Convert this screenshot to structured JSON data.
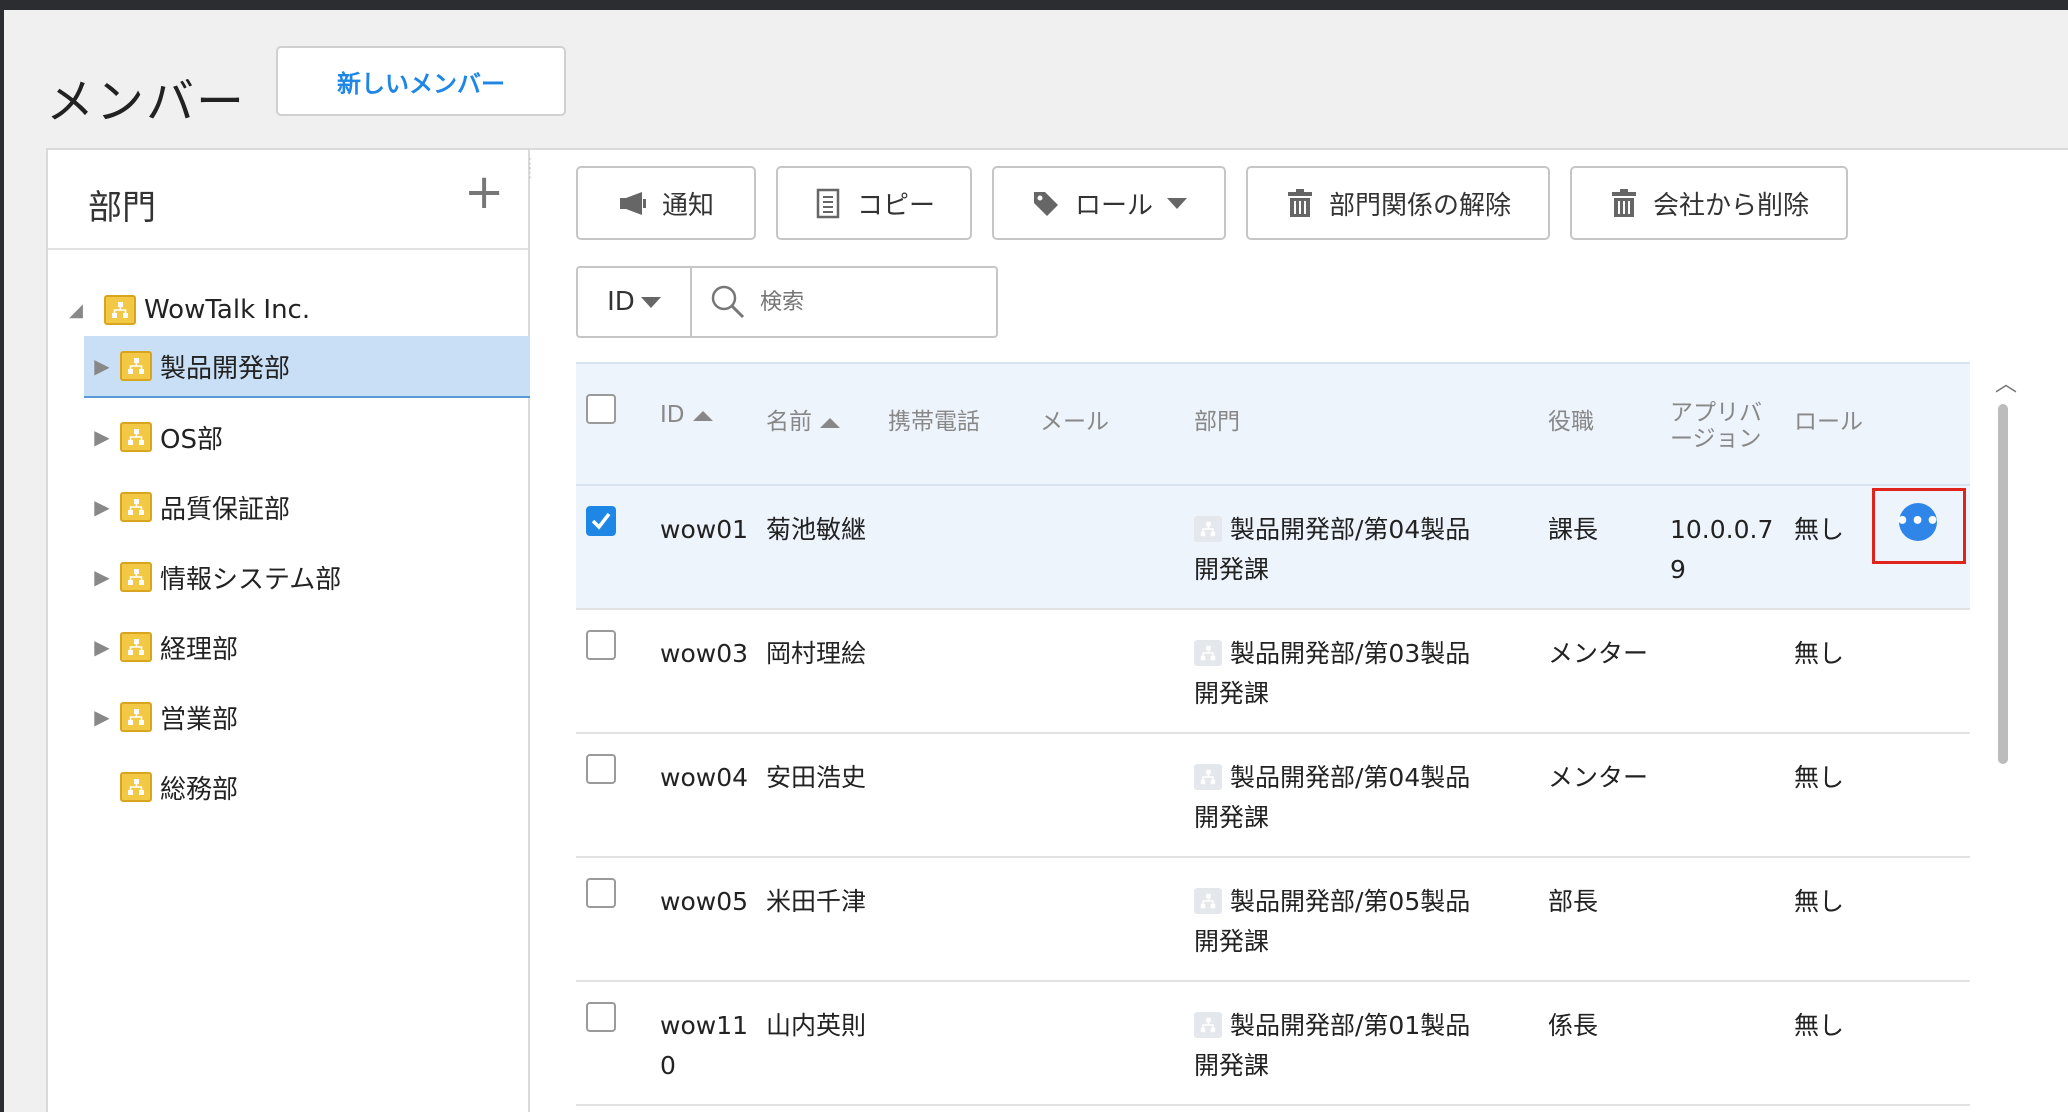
{
  "header": {
    "title": "メンバー",
    "new_member_label": "新しいメンバー"
  },
  "departments": {
    "title": "部門",
    "add_icon": "plus-icon",
    "root": "WowTalk Inc.",
    "items": [
      {
        "label": "製品開発部",
        "expandable": true,
        "selected": true
      },
      {
        "label": "OS部",
        "expandable": true,
        "selected": false
      },
      {
        "label": "品質保証部",
        "expandable": true,
        "selected": false
      },
      {
        "label": "情報システム部",
        "expandable": true,
        "selected": false
      },
      {
        "label": "経理部",
        "expandable": true,
        "selected": false
      },
      {
        "label": "営業部",
        "expandable": true,
        "selected": false
      },
      {
        "label": "総務部",
        "expandable": false,
        "selected": false
      }
    ]
  },
  "toolbar": {
    "notify": "通知",
    "copy": "コピー",
    "role": "ロール",
    "remove_dept": "部門関係の解除",
    "remove_company": "会社から削除"
  },
  "search": {
    "field": "ID",
    "placeholder": "検索"
  },
  "table": {
    "columns": {
      "id": "ID",
      "name": "名前",
      "mobile": "携帯電話",
      "email": "メール",
      "department": "部門",
      "position": "役職",
      "app_version": "アプリバ\nージョン",
      "role": "ロール"
    },
    "rows": [
      {
        "checked": true,
        "id": "wow01",
        "name": "菊池敏継",
        "dept_line1": "製品開発部/第04製品",
        "dept_line2": "開発課",
        "position": "課長",
        "app_version": "10.0.0.7\n9",
        "role": "無し",
        "selected": true
      },
      {
        "checked": false,
        "id": "wow03",
        "name": "岡村理絵",
        "dept_line1": "製品開発部/第03製品",
        "dept_line2": "開発課",
        "position": "メンター",
        "app_version": "",
        "role": "無し",
        "selected": false
      },
      {
        "checked": false,
        "id": "wow04",
        "name": "安田浩史",
        "dept_line1": "製品開発部/第04製品",
        "dept_line2": "開発課",
        "position": "メンター",
        "app_version": "",
        "role": "無し",
        "selected": false
      },
      {
        "checked": false,
        "id": "wow05",
        "name": "米田千津",
        "dept_line1": "製品開発部/第05製品",
        "dept_line2": "開発課",
        "position": "部長",
        "app_version": "",
        "role": "無し",
        "selected": false
      },
      {
        "checked": false,
        "id": "wow11\n0",
        "name": "山内英則",
        "dept_line1": "製品開発部/第01製品",
        "dept_line2": "開発課",
        "position": "係長",
        "app_version": "",
        "role": "無し",
        "selected": false
      }
    ]
  },
  "colors": {
    "accent": "#1e87e5",
    "highlight_frame": "#e0241b",
    "selected_row": "#edf4fc",
    "tree_selected": "#c9dff5"
  }
}
